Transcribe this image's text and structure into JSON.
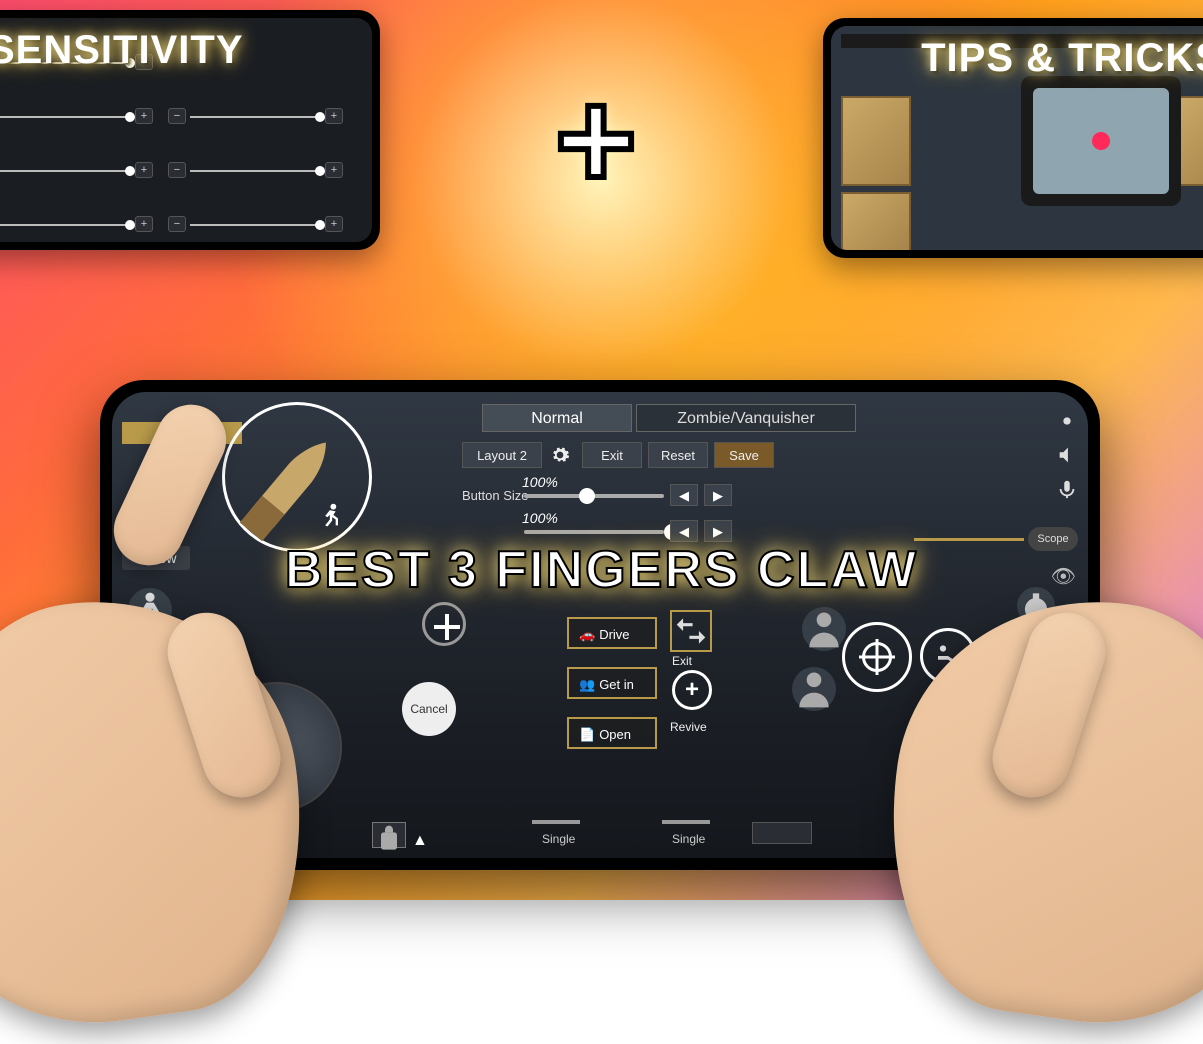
{
  "titles": {
    "left": "SENSITIVITY",
    "right": "TIPS & TRICKS",
    "main": "BEST 3 FINGERS CLAW"
  },
  "plus": "+",
  "game": {
    "tabs": {
      "normal": "Normal",
      "zombie": "Zombie/Vanquisher"
    },
    "toolbar": {
      "layout": "Layout 2",
      "exit": "Exit",
      "reset": "Reset",
      "save": "Save"
    },
    "sliders": {
      "buttonSize": {
        "label": "Button Size",
        "value": "100%"
      },
      "alpha": {
        "value": "100%"
      }
    },
    "left": {
      "follow": "Follow",
      "sprint": "Sprint"
    },
    "actions": {
      "drive": "Drive",
      "getin": "Get in",
      "open": "Open",
      "cancel": "Cancel",
      "exit": "Exit",
      "revive": "Revive"
    },
    "right": {
      "scope": "Scope"
    },
    "bottom": {
      "single1": "Single",
      "single2": "Single"
    }
  }
}
